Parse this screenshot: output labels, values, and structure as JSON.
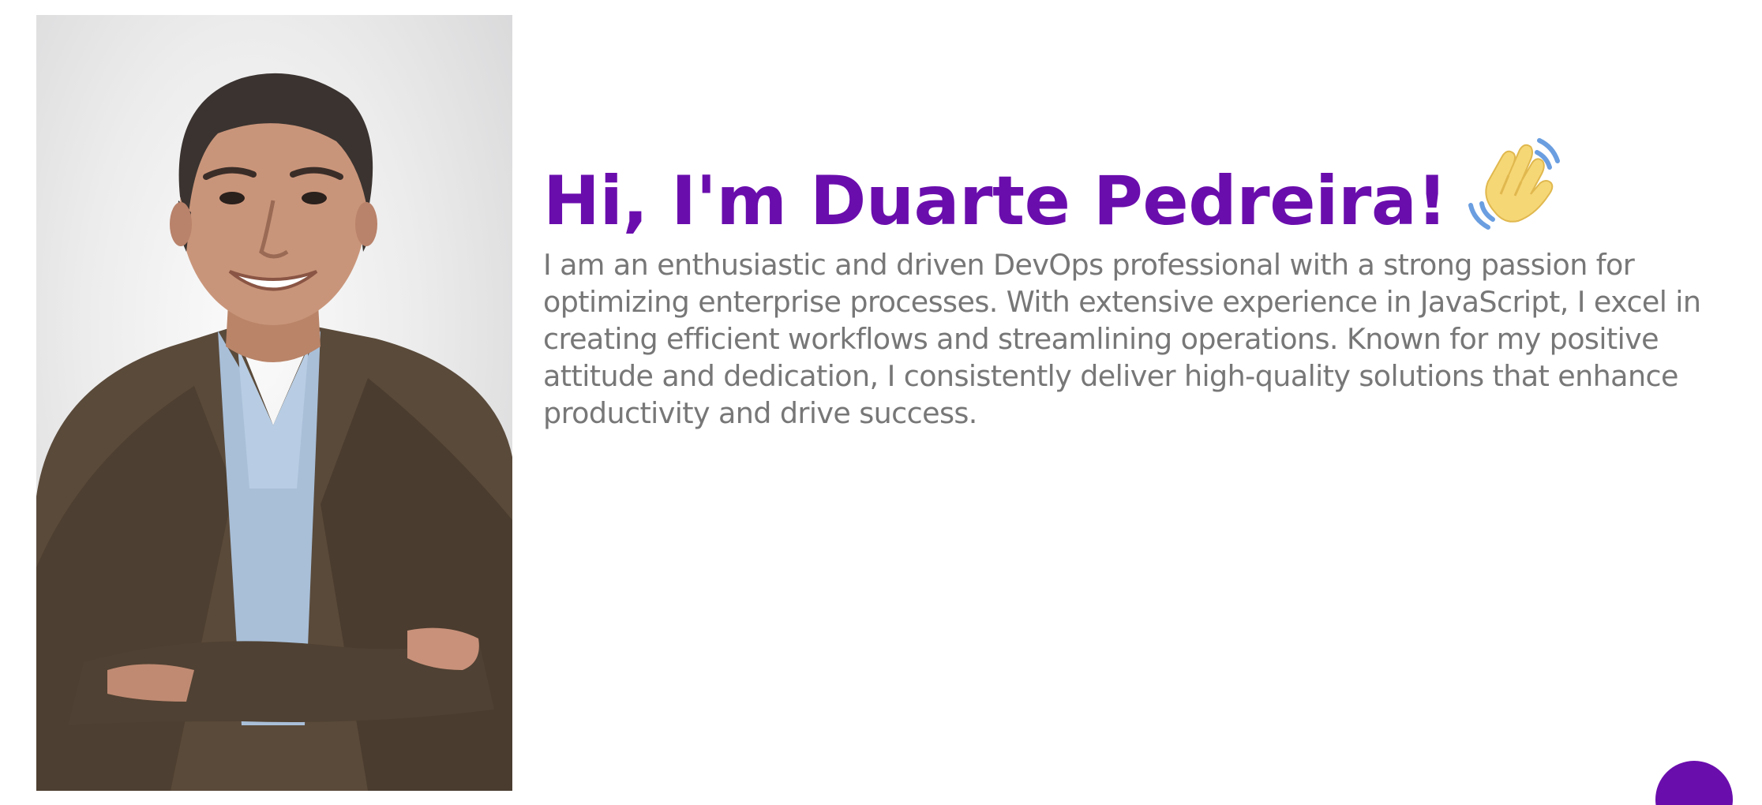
{
  "hero": {
    "greeting": "Hi, I'm Duarte Pedreira!",
    "wave_icon": "waving-hand-icon",
    "bio": "I am an enthusiastic and driven DevOps professional with a strong passion for optimizing enterprise processes. With extensive experience in JavaScript, I excel in creating efficient workflows and streamlining operations. Known for my positive attitude and dedication, I consistently deliver high-quality solutions that enhance productivity and drive success."
  },
  "colors": {
    "accent": "#6a0dad",
    "body_text": "#777777",
    "background": "#ffffff"
  },
  "floating_button": {
    "icon": "circle-button"
  }
}
